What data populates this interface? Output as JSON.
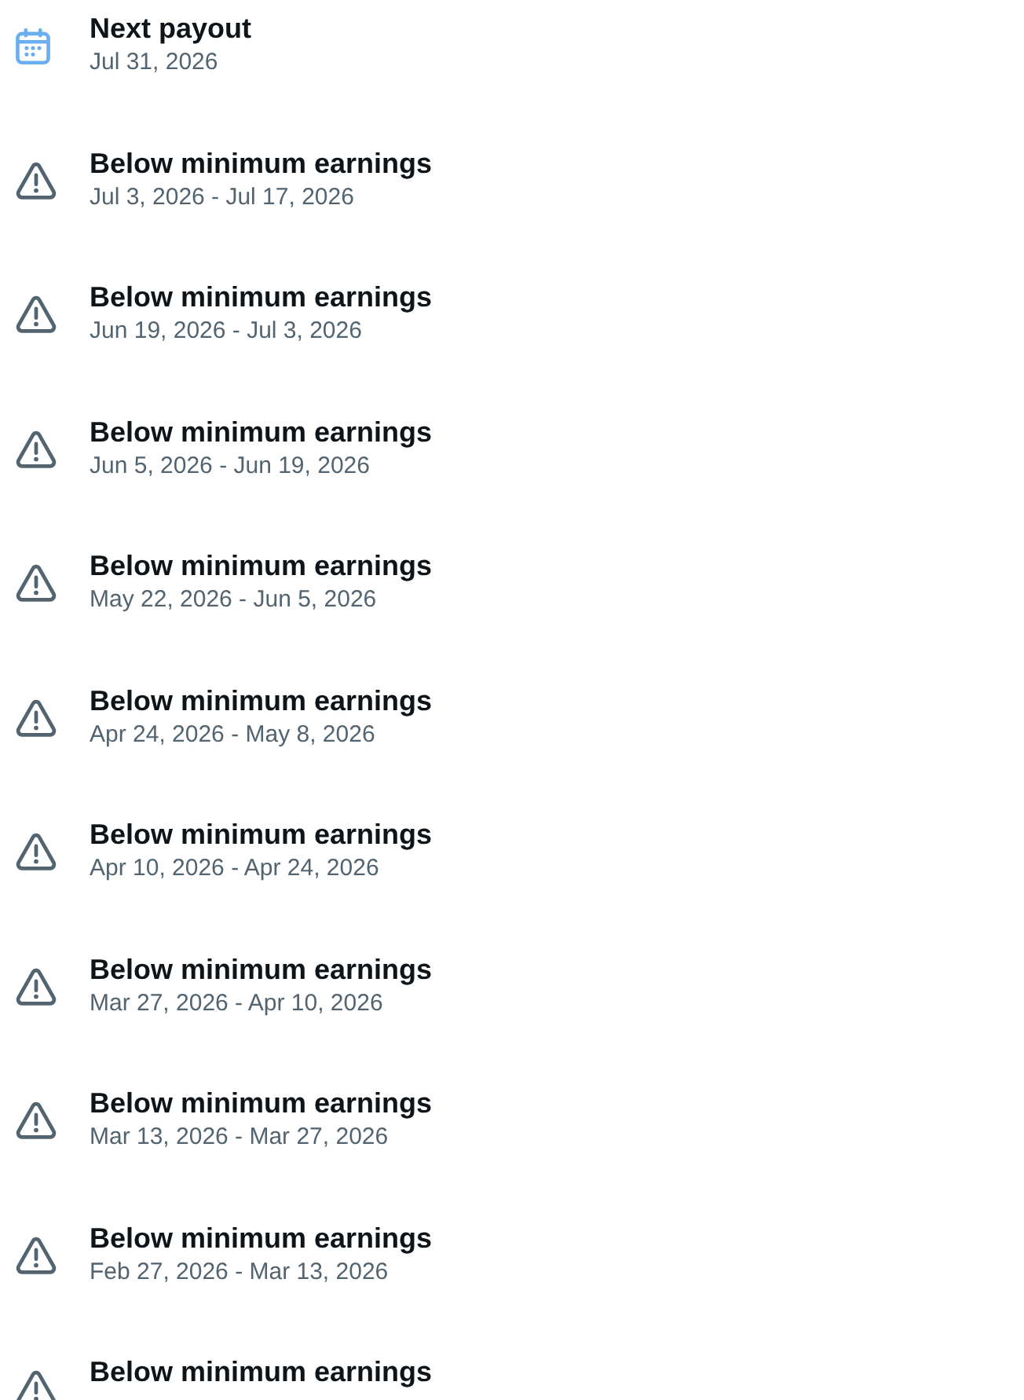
{
  "payouts": [
    {
      "kind": "payout",
      "title": "Next payout",
      "date": "Jul 31, 2026"
    },
    {
      "kind": "warning",
      "title": "Below minimum earnings",
      "date": "Jul 3, 2026 - Jul 17, 2026"
    },
    {
      "kind": "warning",
      "title": "Below minimum earnings",
      "date": "Jun 19, 2026 - Jul 3, 2026"
    },
    {
      "kind": "warning",
      "title": "Below minimum earnings",
      "date": "Jun 5, 2026 - Jun 19, 2026"
    },
    {
      "kind": "warning",
      "title": "Below minimum earnings",
      "date": "May 22, 2026 - Jun 5, 2026"
    },
    {
      "kind": "warning",
      "title": "Below minimum earnings",
      "date": "Apr 24, 2026 - May 8, 2026"
    },
    {
      "kind": "warning",
      "title": "Below minimum earnings",
      "date": "Apr 10, 2026 - Apr 24, 2026"
    },
    {
      "kind": "warning",
      "title": "Below minimum earnings",
      "date": "Mar 27, 2026 - Apr 10, 2026"
    },
    {
      "kind": "warning",
      "title": "Below minimum earnings",
      "date": "Mar 13, 2026 - Mar 27, 2026"
    },
    {
      "kind": "warning",
      "title": "Below minimum earnings",
      "date": "Feb 27, 2026 - Mar 13, 2026"
    },
    {
      "kind": "warning",
      "title": "Below minimum earnings"
    }
  ]
}
